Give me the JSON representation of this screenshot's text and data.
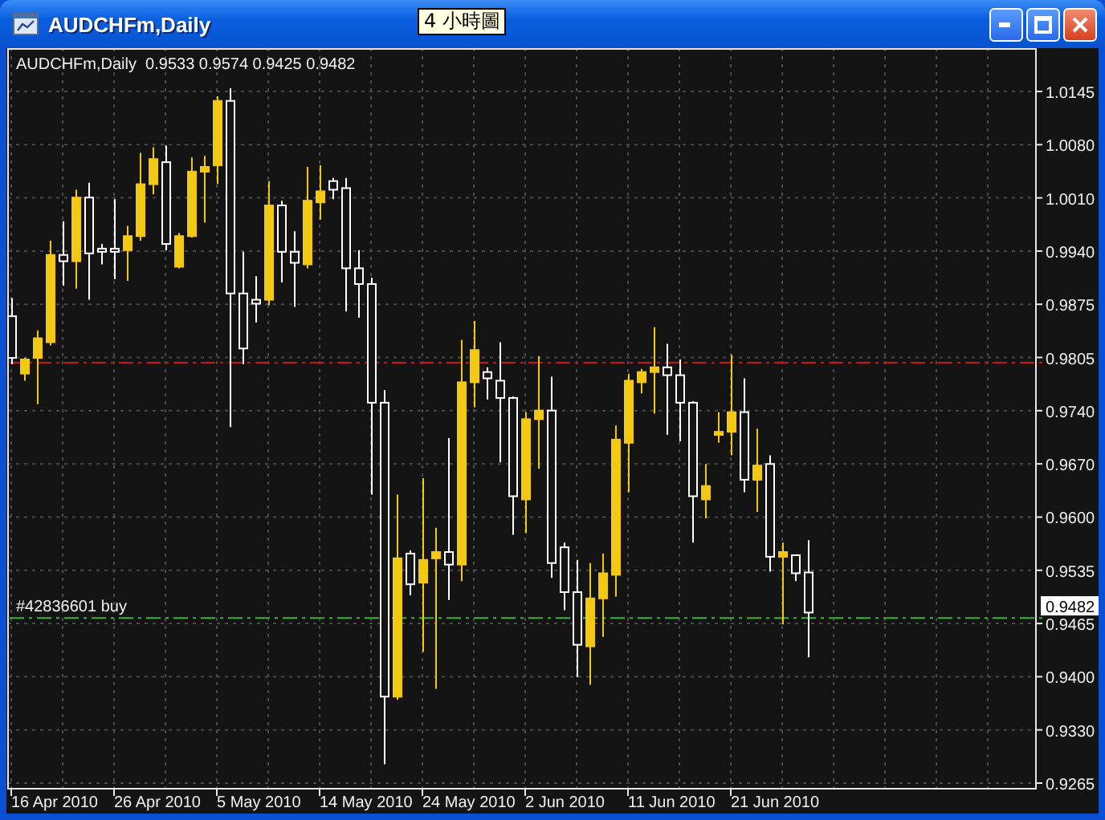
{
  "window": {
    "title": "AUDCHFm,Daily",
    "tooltip": "4 小時圖"
  },
  "chart": {
    "header": "AUDCHFm,Daily  0.9533 0.9574 0.9425 0.9482",
    "price_axis_labels": [
      "1.0145",
      "1.0080",
      "1.0010",
      "0.9940",
      "0.9875",
      "0.9805",
      "0.9740",
      "0.9670",
      "0.9600",
      "0.9535",
      "0.9465",
      "0.9400",
      "0.9330",
      "0.9265"
    ],
    "date_axis_labels": [
      "16 Apr 2010",
      "26 Apr 2010",
      "5 May 2010",
      "14 May 2010",
      "24 May 2010",
      "2 Jun 2010",
      "11 Jun 2010",
      "21 Jun 2010"
    ],
    "order_label": "#42836601 buy",
    "price_label": "0.9482"
  }
}
